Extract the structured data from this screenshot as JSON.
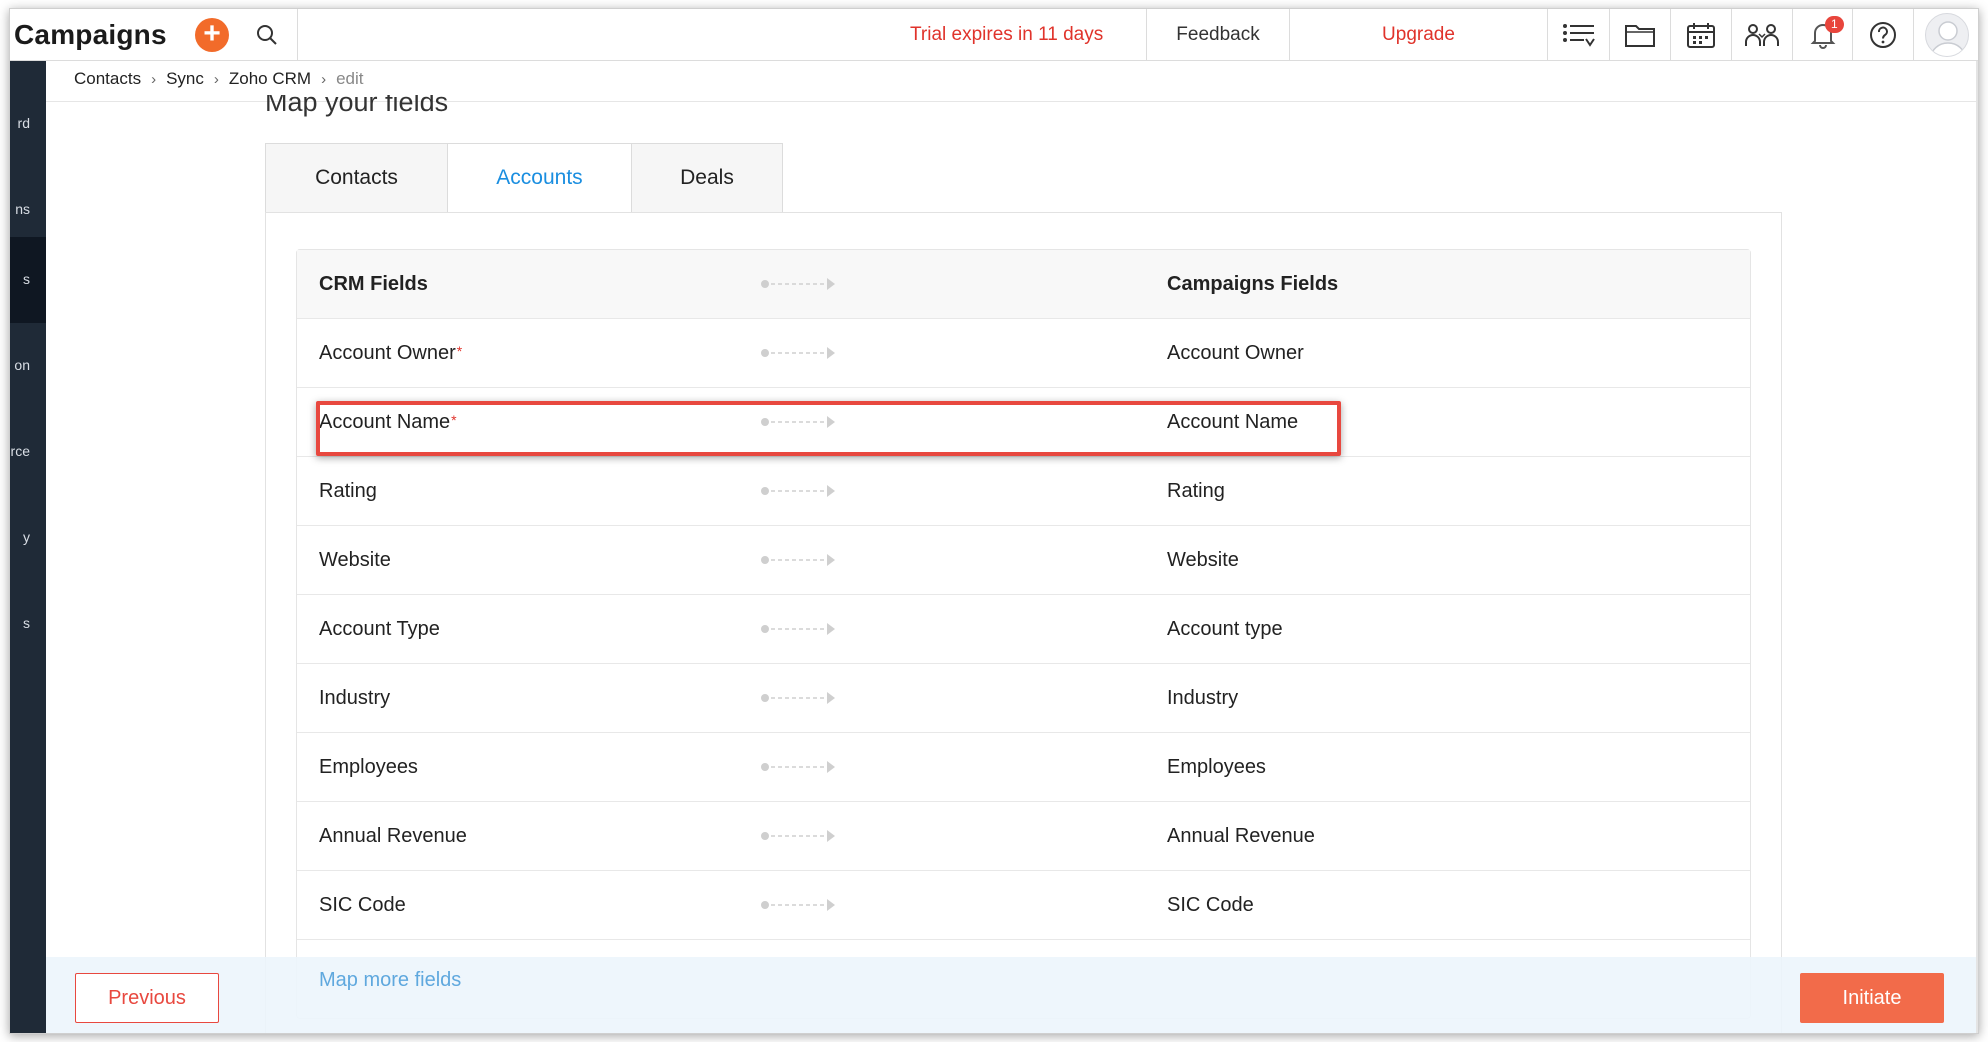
{
  "header": {
    "brand": "Campaigns",
    "add_label": "+",
    "trial_text": "Trial expires in 11 days",
    "feedback_label": "Feedback",
    "upgrade_label": "Upgrade",
    "notification_count": "1",
    "icons": [
      "list-icon",
      "folder-icon",
      "calendar-icon",
      "users-icon",
      "bell-icon",
      "help-icon",
      "avatar"
    ]
  },
  "sidebar": {
    "items": [
      {
        "label": "rd",
        "active": false
      },
      {
        "label": "ns",
        "active": false
      },
      {
        "label": "s",
        "active": true
      },
      {
        "label": "on",
        "active": false
      },
      {
        "label": "rce",
        "active": false
      },
      {
        "label": "y",
        "active": false
      },
      {
        "label": "s",
        "active": false
      }
    ]
  },
  "breadcrumb": {
    "items": [
      "Contacts",
      "Sync",
      "Zoho CRM"
    ],
    "current": "edit"
  },
  "page": {
    "title": "Map your fields"
  },
  "tabs": [
    {
      "label": "Contacts",
      "active": false
    },
    {
      "label": "Accounts",
      "active": true
    },
    {
      "label": "Deals",
      "active": false
    }
  ],
  "mapping": {
    "header": {
      "crm": "CRM Fields",
      "campaigns": "Campaigns Fields"
    },
    "rows": [
      {
        "crm": "Account Owner",
        "required": true,
        "campaigns": "Account Owner"
      },
      {
        "crm": "Account Name",
        "required": true,
        "campaigns": "Account Name"
      },
      {
        "crm": "Rating",
        "required": false,
        "campaigns": "Rating"
      },
      {
        "crm": "Website",
        "required": false,
        "campaigns": "Website"
      },
      {
        "crm": "Account Type",
        "required": false,
        "campaigns": "Account type"
      },
      {
        "crm": "Industry",
        "required": false,
        "campaigns": "Industry"
      },
      {
        "crm": "Employees",
        "required": false,
        "campaigns": "Employees"
      },
      {
        "crm": "Annual Revenue",
        "required": false,
        "campaigns": "Annual Revenue"
      },
      {
        "crm": "SIC Code",
        "required": false,
        "campaigns": "SIC Code"
      }
    ],
    "required_mark": "*",
    "map_more_label": "Map more fields"
  },
  "footer": {
    "previous_label": "Previous",
    "initiate_label": "Initiate"
  },
  "colors": {
    "accent_orange": "#f26b2a",
    "alert_red": "#e0332b",
    "link_blue": "#1a8ee0",
    "sidebar_bg": "#1f2a37"
  }
}
